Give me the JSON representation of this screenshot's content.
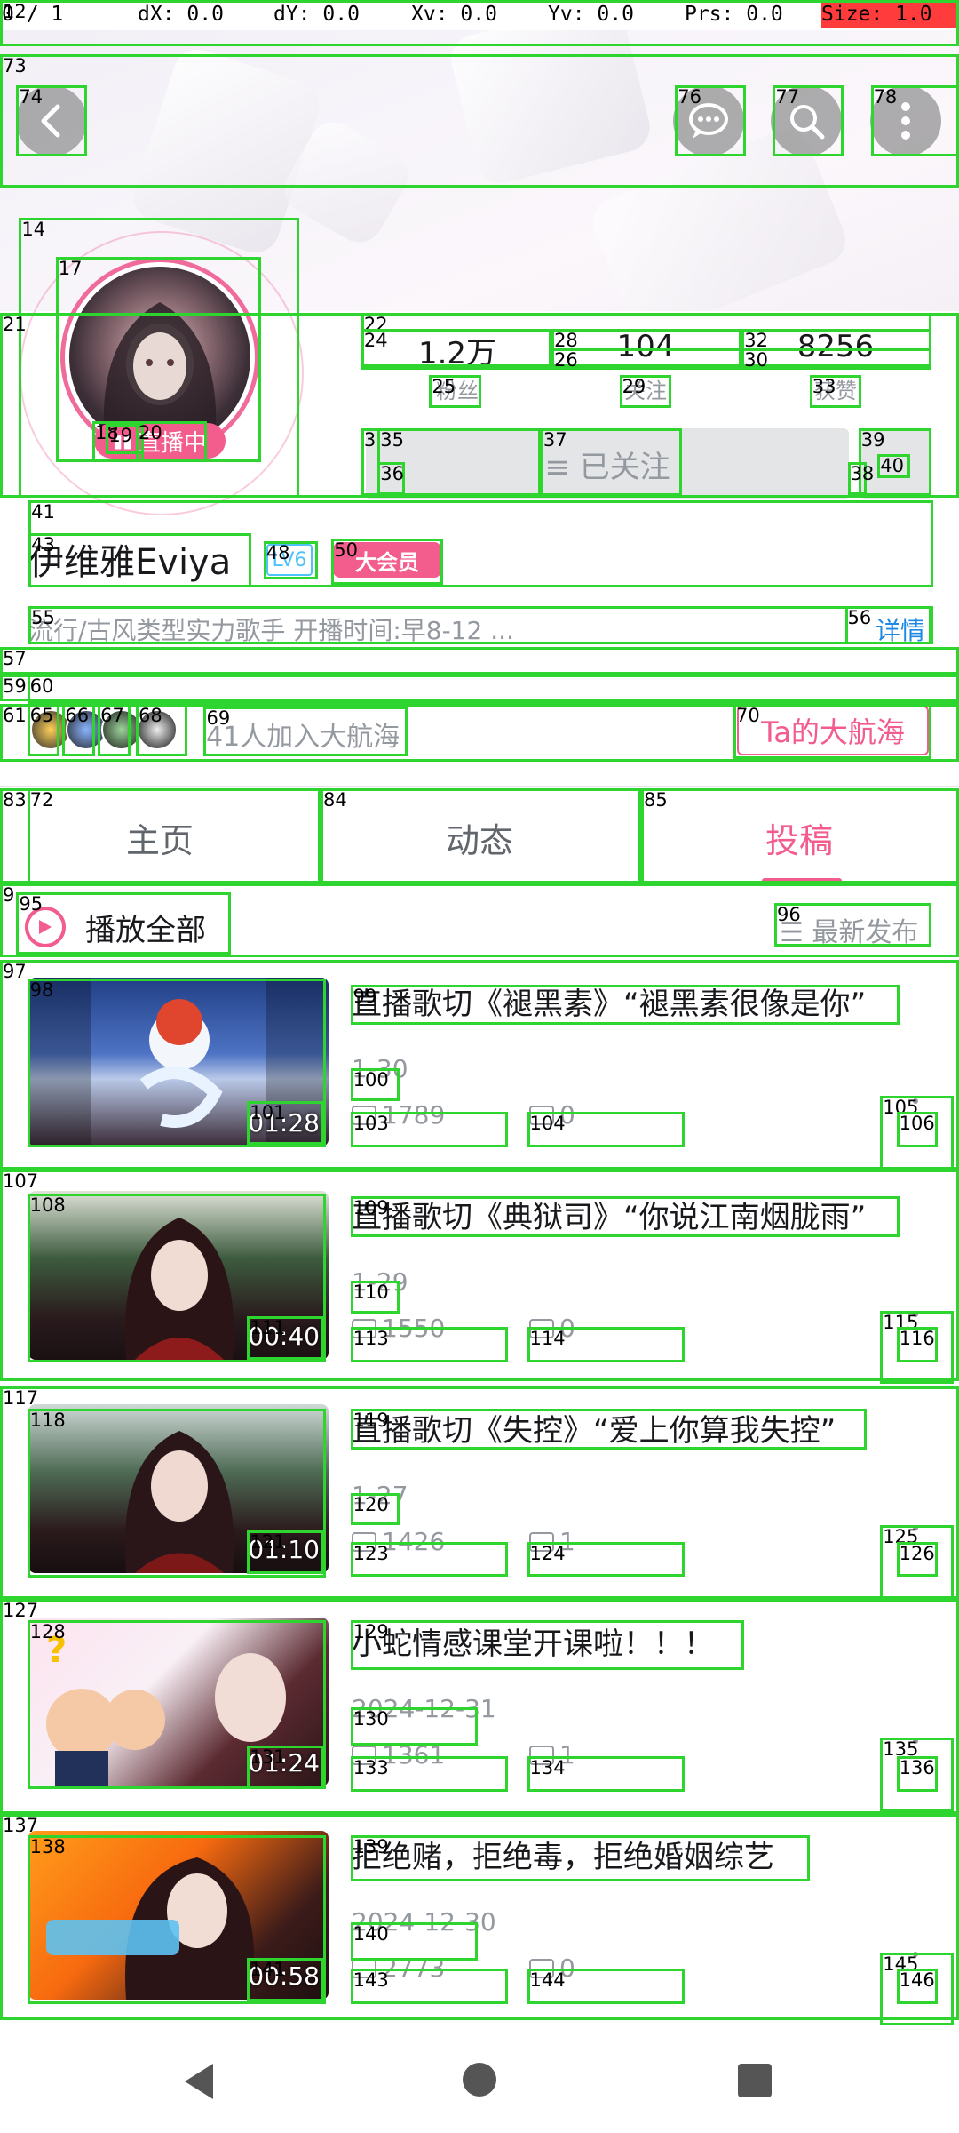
{
  "debug": {
    "pointers": "0 / 1",
    "dx": "dX: 0.0",
    "dy": "dY: 0.0",
    "xv": "Xv: 0.0",
    "yv": "Yv: 0.0",
    "prs": "Prs: 0.0",
    "size": "Size: 1.0"
  },
  "profile": {
    "name": "伊维雅Eviya",
    "level": "LV6",
    "vip": "大会员",
    "live_badge": "直播中",
    "signature": "流行/古风类型实力歌手  开播时间:早8-12 ...",
    "detail": "详情",
    "stats": [
      {
        "value": "1.2万",
        "label": "粉丝"
      },
      {
        "value": "104",
        "label": "关注"
      },
      {
        "value": "8256",
        "label": "获赞"
      }
    ],
    "follow_label": "≡ 已关注",
    "fleet_count_text": "41人加入大航海",
    "fleet_button": "Ta的大航海"
  },
  "tabs": [
    {
      "label": "主页"
    },
    {
      "label": "动态"
    },
    {
      "label": "投稿"
    }
  ],
  "playall_label": "播放全部",
  "sort_label": "☰ 最新发布",
  "videos": [
    {
      "title": "直播歌切《褪黑素》“褪黑素很像是你”",
      "date": "1-30",
      "plays": "1789",
      "danmu": "0",
      "duration": "01:28"
    },
    {
      "title": "直播歌切《典狱司》“你说江南烟胧雨”",
      "date": "1-29",
      "plays": "1550",
      "danmu": "0",
      "duration": "00:40"
    },
    {
      "title": "直播歌切《失控》“爱上你算我失控”",
      "date": "1-27",
      "plays": "1426",
      "danmu": "1",
      "duration": "01:10"
    },
    {
      "title": "小蛇情感课堂开课啦！！！",
      "date": "2024-12-31",
      "plays": "1361",
      "danmu": "1",
      "duration": "01:24"
    },
    {
      "title": "拒绝赌，拒绝毒，拒绝婚姻综艺",
      "date": "2024-12-30",
      "plays": "2773",
      "danmu": "0",
      "duration": "00:58"
    }
  ],
  "overlay": {
    "numbers": [
      "12",
      "73",
      "74",
      "76",
      "77",
      "78",
      "14",
      "17",
      "21",
      "22",
      "24",
      "28",
      "26",
      "32",
      "30",
      "25",
      "29",
      "33",
      "3",
      "35",
      "36",
      "37",
      "39",
      "38",
      "40",
      "18",
      "19",
      "20",
      "41",
      "43",
      "48",
      "50",
      "55",
      "56",
      "57",
      "59",
      "60",
      "61",
      "65",
      "66",
      "67",
      "68",
      "69",
      "70",
      "83",
      "72",
      "84",
      "85",
      "9",
      "95",
      "96",
      "97",
      "98",
      "99",
      "100",
      "101",
      "103",
      "104",
      "105",
      "106",
      "107",
      "108",
      "109",
      "110",
      "111",
      "113",
      "114",
      "115",
      "116",
      "117",
      "118",
      "119",
      "120",
      "121",
      "123",
      "124",
      "125",
      "126",
      "127",
      "128",
      "129",
      "130",
      "131",
      "133",
      "134",
      "135",
      "136",
      "137",
      "138",
      "139",
      "140",
      "141",
      "143",
      "144",
      "145",
      "146"
    ]
  },
  "colors": {
    "accent": "#f25d8e",
    "link": "#1e88e5",
    "box": "#2ed52e"
  }
}
